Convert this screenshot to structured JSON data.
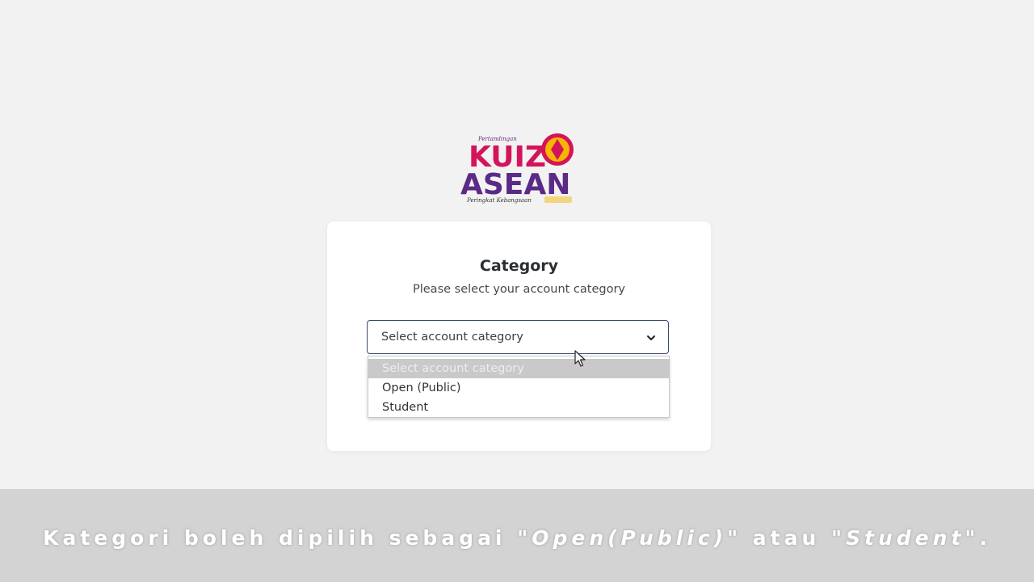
{
  "logo": {
    "top_text": "Pertandingan",
    "line1": "KUIZ",
    "line2": "ASEAN",
    "bottom_text": "Peringkat Kebangsaan"
  },
  "card": {
    "title": "Category",
    "subtitle": "Please select your account category"
  },
  "select": {
    "value": "Select account category",
    "icon": "chevron-down-icon",
    "options": [
      {
        "label": "Select account category"
      },
      {
        "label": "Open (Public)"
      },
      {
        "label": "Student"
      }
    ]
  },
  "caption": {
    "prefix": "Kategori boleh dipilih sebagai \"",
    "opt1": "Open(Public)",
    "middle": "\" atau \"",
    "opt2": "Student",
    "suffix": "\"."
  },
  "colors": {
    "background": "#f2f2f2",
    "select_border": "#3a4b6b",
    "highlight_option": "#c9c9c9",
    "caption_bar": "#d3d3d3"
  }
}
